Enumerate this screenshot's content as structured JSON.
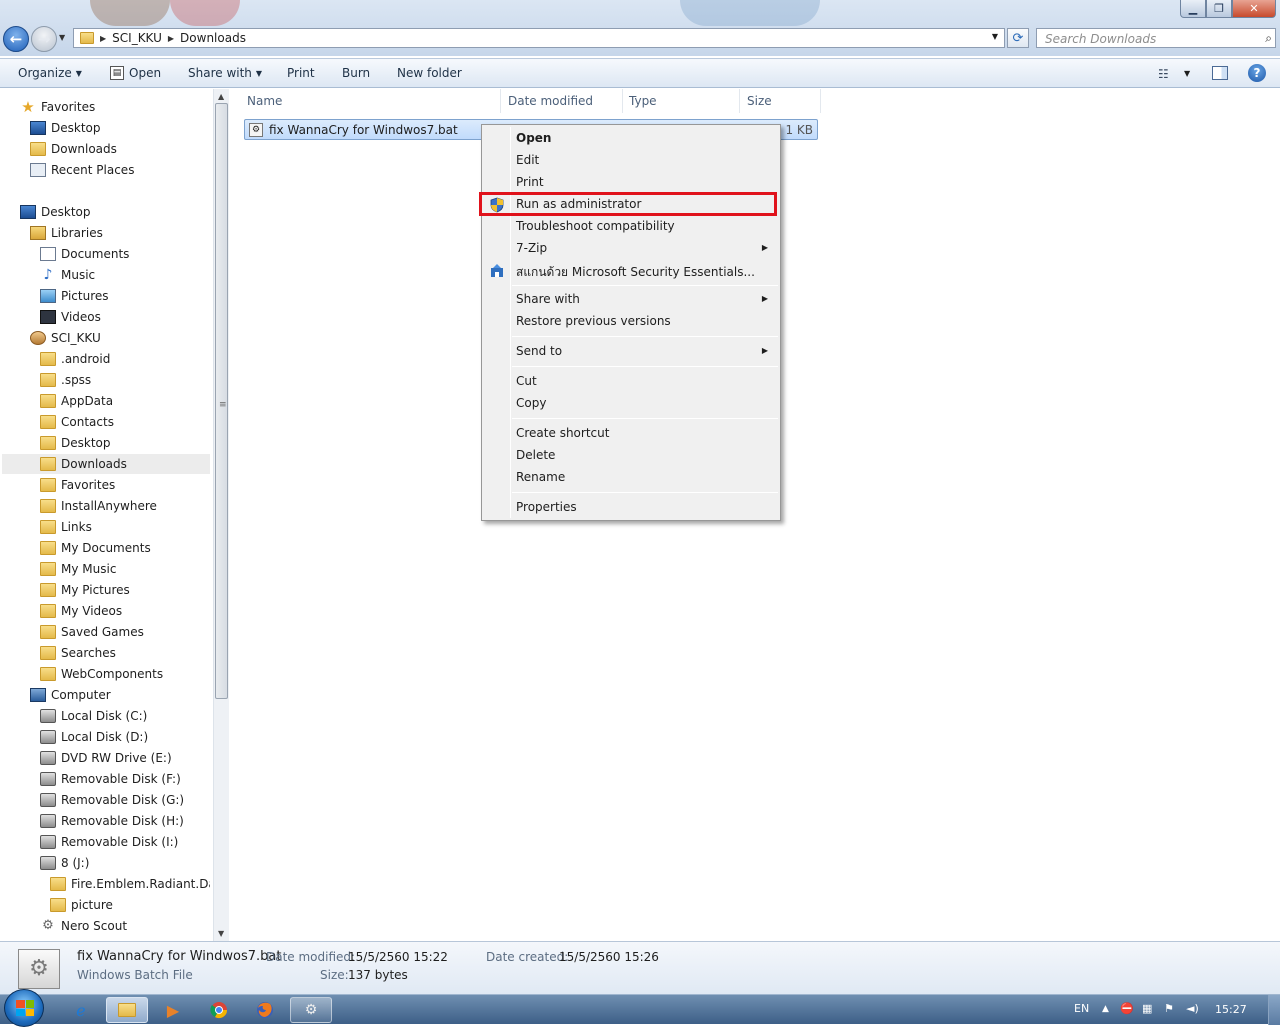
{
  "address": {
    "crumbs": [
      "SCI_KKU",
      "Downloads"
    ],
    "search_placeholder": "Search Downloads"
  },
  "toolbar": {
    "organize": "Organize",
    "open": "Open",
    "share_with": "Share with",
    "print": "Print",
    "burn": "Burn",
    "new_folder": "New folder"
  },
  "nav": {
    "favorites": "Favorites",
    "fav_desktop": "Desktop",
    "fav_downloads": "Downloads",
    "fav_recent": "Recent Places",
    "desktop": "Desktop",
    "libraries": "Libraries",
    "documents": "Documents",
    "music": "Music",
    "pictures": "Pictures",
    "videos": "Videos",
    "user": "SCI_KKU",
    "user_folders": [
      ".android",
      ".spss",
      "AppData",
      "Contacts",
      "Desktop",
      "Downloads",
      "Favorites",
      "InstallAnywhere",
      "Links",
      "My Documents",
      "My Music",
      "My Pictures",
      "My Videos",
      "Saved Games",
      "Searches",
      "WebComponents"
    ],
    "computer": "Computer",
    "drives": [
      "Local Disk (C:)",
      "Local Disk (D:)",
      "DVD RW Drive (E:)",
      "Removable Disk (F:)",
      "Removable Disk (G:)",
      "Removable Disk (H:)",
      "Removable Disk (I:)",
      "8 (J:)"
    ],
    "j_folders": [
      "Fire.Emblem.Radiant.Dawn",
      "picture"
    ],
    "nero": "Nero Scout"
  },
  "columns": {
    "name": "Name",
    "date_modified": "Date modified",
    "type": "Type",
    "size": "Size"
  },
  "file": {
    "name": "fix WannaCry for Windwos7.bat",
    "size": "1 KB"
  },
  "context_menu": {
    "open": "Open",
    "edit": "Edit",
    "print": "Print",
    "run_as_admin": "Run as administrator",
    "troubleshoot": "Troubleshoot compatibility",
    "zip": "7-Zip",
    "scan": "สแกนด้วย Microsoft Security Essentials...",
    "share_with": "Share with",
    "restore": "Restore previous versions",
    "send_to": "Send to",
    "cut": "Cut",
    "copy": "Copy",
    "create_shortcut": "Create shortcut",
    "delete": "Delete",
    "rename": "Rename",
    "properties": "Properties"
  },
  "details": {
    "filename": "fix WannaCry for Windwos7.bat",
    "filetype": "Windows Batch File",
    "date_modified_label": "Date modified:",
    "date_modified": "15/5/2560 15:22",
    "size_label": "Size:",
    "size": "137 bytes",
    "date_created_label": "Date created:",
    "date_created": "15/5/2560 15:26"
  },
  "taskbar": {
    "lang": "EN",
    "time": "15:27"
  },
  "colors": {
    "highlight_box": "#e0121b",
    "selection": "#c1dbfc"
  }
}
